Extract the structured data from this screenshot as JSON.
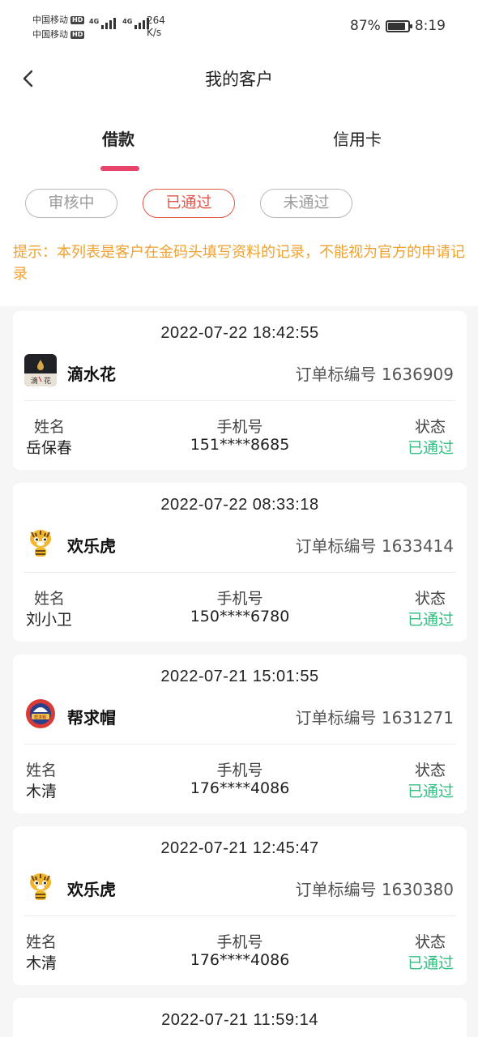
{
  "status_bar": {
    "carrier_1": "中国移动",
    "carrier_2": "中国移动",
    "hd": "HD",
    "network_1": "4G",
    "network_2": "4G",
    "speed_value": "264",
    "speed_unit": "K/s",
    "battery": "87%",
    "battery_level": 0.87,
    "time": "8:19"
  },
  "header": {
    "title": "我的客户",
    "back_icon": "chevron-left-icon"
  },
  "tabs": [
    {
      "label": "借款",
      "active": true
    },
    {
      "label": "信用卡",
      "active": false
    }
  ],
  "filters": [
    {
      "label": "审核中",
      "active": false
    },
    {
      "label": "已通过",
      "active": true
    },
    {
      "label": "未通过",
      "active": false
    }
  ],
  "notice": "提示：本列表是客户在金码头填写资料的记录，不能视为官方的申请记录",
  "columns": {
    "name": "姓名",
    "phone": "手机号",
    "status": "状态"
  },
  "records": [
    {
      "time": "2022-07-22 18:42:55",
      "app": "滴水花",
      "logo": "dishuihua-logo",
      "order": "订单标编号 1636909",
      "name": "岳保春",
      "phone": "151****8685",
      "status": "已通过"
    },
    {
      "time": "2022-07-22 08:33:18",
      "app": "欢乐虎",
      "logo": "tiger-logo",
      "order": "订单标编号 1633414",
      "name": "刘小卫",
      "phone": "150****6780",
      "status": "已通过"
    },
    {
      "time": "2022-07-21 15:01:55",
      "app": "帮求帽",
      "logo": "bangqiumao-logo",
      "order": "订单标编号 1631271",
      "name": "木清",
      "phone": "176****4086",
      "status": "已通过"
    },
    {
      "time": "2022-07-21 12:45:47",
      "app": "欢乐虎",
      "logo": "tiger-logo",
      "order": "订单标编号 1630380",
      "name": "木清",
      "phone": "176****4086",
      "status": "已通过"
    },
    {
      "time": "2022-07-21 11:59:14"
    }
  ],
  "colors": {
    "accent": "#e8436a",
    "approved_chip": "#e25548",
    "notice": "#f0a12f",
    "status_ok": "#2ec080"
  }
}
